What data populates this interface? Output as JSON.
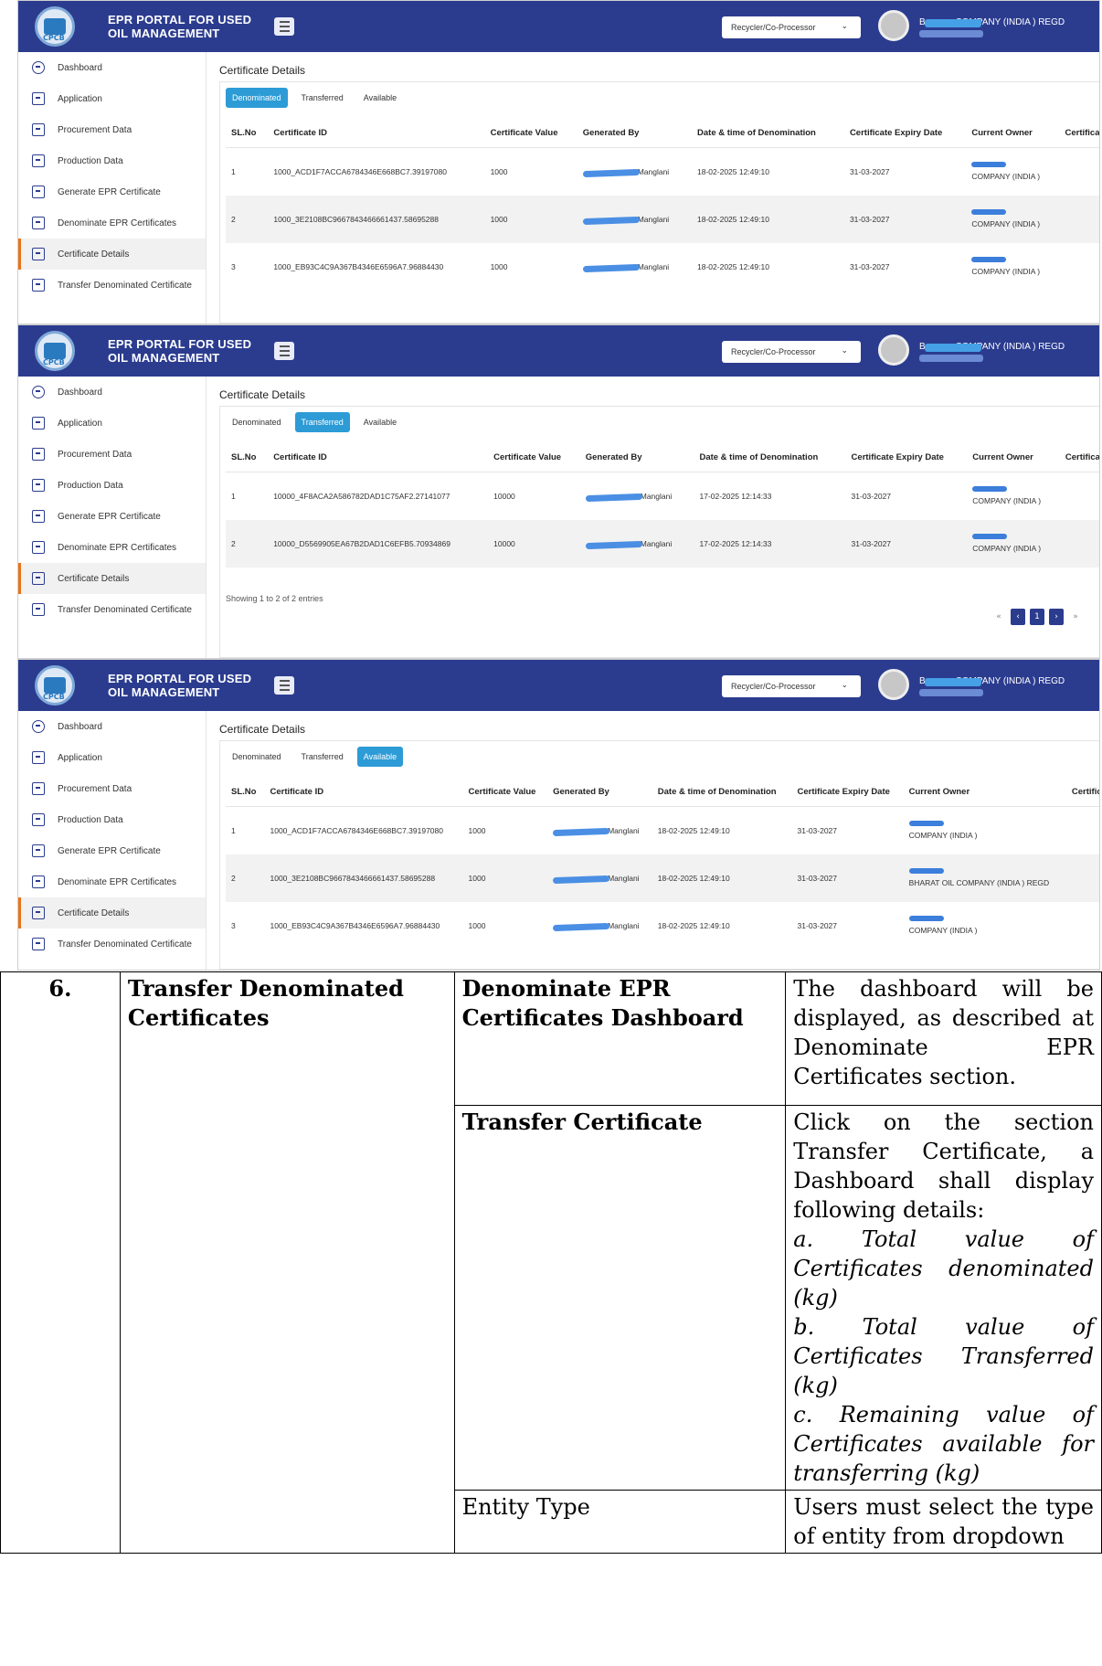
{
  "portal": {
    "title": "EPR PORTAL FOR USED OIL MANAGEMENT",
    "logo_text": "CPCB",
    "company": "B▬▬▬ COMPANY (INDIA ) REGD"
  },
  "screens": [
    {
      "role_select": "Recycler/Co-Processor",
      "active_tab": "Denominated",
      "rows": [
        {
          "sl": "1",
          "id": "1000_ACD1F7ACCA6784346E668BC7.39197080",
          "value": "1000",
          "gen": "Manglani",
          "date": "18-02-2025 12:49:10",
          "expiry": "31-03-2027",
          "owner": "COMPANY (INDIA )"
        },
        {
          "sl": "2",
          "id": "1000_3E2108BC9667843466661437.58695288",
          "value": "1000",
          "gen": "Manglani",
          "date": "18-02-2025 12:49:10",
          "expiry": "31-03-2027",
          "owner": "COMPANY (INDIA )"
        },
        {
          "sl": "3",
          "id": "1000_EB93C4C9A367B4346E6596A7.96884430",
          "value": "1000",
          "gen": "Manglani",
          "date": "18-02-2025 12:49:10",
          "expiry": "31-03-2027",
          "owner": "COMPANY (INDIA )"
        }
      ]
    },
    {
      "role_select": "Recycler/Co-Processor",
      "active_tab": "Transferred",
      "rows": [
        {
          "sl": "1",
          "id": "10000_4F8ACA2A586782DAD1C75AF2.27141077",
          "value": "10000",
          "gen": "Manglani",
          "date": "17-02-2025 12:14:33",
          "expiry": "31-03-2027",
          "owner": "COMPANY (INDIA )"
        },
        {
          "sl": "2",
          "id": "10000_D5569905EA67B2DAD1C6EFB5.70934869",
          "value": "10000",
          "gen": "Manglani",
          "date": "17-02-2025 12:14:33",
          "expiry": "31-03-2027",
          "owner": "COMPANY (INDIA )"
        }
      ],
      "info": "Showing 1 to 2 of 2 entries",
      "page": "1"
    },
    {
      "role_select": "Recycler/Co-Processor",
      "active_tab": "Available",
      "rows": [
        {
          "sl": "1",
          "id": "1000_ACD1F7ACCA6784346E668BC7.39197080",
          "value": "1000",
          "gen": "Manglani",
          "date": "18-02-2025 12:49:10",
          "expiry": "31-03-2027",
          "owner": "COMPANY (INDIA )"
        },
        {
          "sl": "2",
          "id": "1000_3E2108BC9667843466661437.58695288",
          "value": "1000",
          "gen": "Manglani",
          "date": "18-02-2025 12:49:10",
          "expiry": "31-03-2027",
          "owner": "BHARAT OIL COMPANY (INDIA ) REGD"
        },
        {
          "sl": "3",
          "id": "1000_EB93C4C9A367B4346E6596A7.96884430",
          "value": "1000",
          "gen": "Manglani",
          "date": "18-02-2025 12:49:10",
          "expiry": "31-03-2027",
          "owner": "COMPANY (INDIA )"
        }
      ]
    }
  ],
  "sidebar": [
    "Dashboard",
    "Application",
    "Procurement Data",
    "Production Data",
    "Generate EPR Certificate",
    "Denominate EPR Certificates",
    "Certificate Details",
    "Transfer Denominated Certificate"
  ],
  "page_title": "Certificate Details",
  "tabs": [
    "Denominated",
    "Transferred",
    "Available"
  ],
  "columns": [
    "SL.No",
    "Certificate ID",
    "Certificate Value",
    "Generated By",
    "Date & time of Denomination",
    "Certificate Expiry Date",
    "Current Owner",
    "Certificate Mc"
  ],
  "spec": {
    "num": "6.",
    "name": "Transfer Denominated Certificates",
    "rows": [
      {
        "head": "Denominate EPR Certificates Dashboard",
        "desc": "The dashboard will be displayed, as described at Denominate EPR Certificates section."
      },
      {
        "head": "Transfer Certificate",
        "desc": "Click on the section Transfer Certificate, a Dashboard shall display following details:",
        "items": [
          "a. Total value of Certificates denominated (kg)",
          "b. Total value of Certificates Transferred (kg)",
          "c. Remaining value of Certificates available for transferring (kg)"
        ]
      },
      {
        "head": "Entity Type",
        "desc": "Users must select the type of entity from dropdown"
      }
    ]
  }
}
